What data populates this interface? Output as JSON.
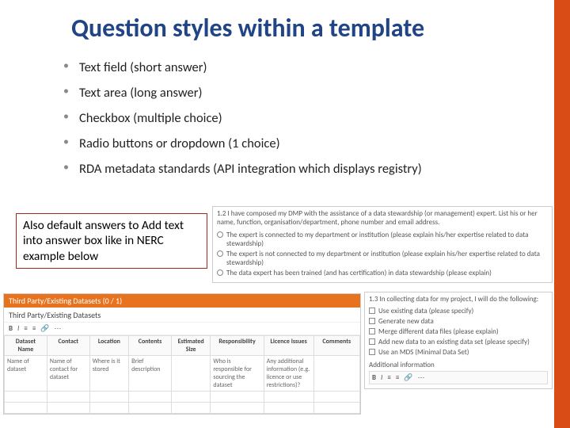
{
  "title": "Question styles within a template",
  "bullets": [
    "Text field (short answer)",
    "Text area (long answer)",
    "Checkbox (multiple choice)",
    "Radio buttons or dropdown (1 choice)",
    "RDA metadata standards (API integration which displays registry)"
  ],
  "callout": "Also default answers to Add text into answer box like in NERC example below",
  "panel12": {
    "question": "1.2 I have composed my DMP with the assistance of a data stewardship (or management) expert. List his or her name, function, organisation/department, phone number and email address.",
    "options": [
      "The expert is connected to my department or institution (please explain his/her expertise related to data stewardship)",
      "The expert is not connected to my department or institution (please explain his/her expertise related to data stewardship)",
      "The data expert has been trained (and has certification) in data stewardship (please explain)"
    ]
  },
  "panel13": {
    "question": "1.3 In collecting data for my project, I will do the following:",
    "options": [
      "Use existing data (please specify)",
      "Generate new data",
      "Merge different data files (please explain)",
      "Add new data to an existing data set (please specify)",
      "Use an MDS (Minimal Data Set)"
    ],
    "additional_label": "Additional information",
    "toolbar": {
      "b": "B",
      "i": "I",
      "list1": "≡",
      "list2": "≡",
      "link": "🔗",
      "more": "⋯"
    }
  },
  "nerc": {
    "header": "Third Party/Existing Datasets (0 / 1)",
    "subheader": "Third Party/Existing Datasets",
    "toolbar": {
      "b": "B",
      "i": "I",
      "list1": "≡",
      "list2": "≡",
      "link": "🔗",
      "more": "⋯"
    },
    "columns": [
      "Dataset Name",
      "Contact",
      "Location",
      "Contents",
      "Estimated Size",
      "Responsibility",
      "Licence Issues",
      "Comments"
    ],
    "hints": [
      "Name of dataset",
      "Name of contact for dataset",
      "Where is it stored",
      "Brief description",
      "",
      "Who is responsible for sourcing the dataset",
      "Any additional information (e.g. licence or use restrictions)?",
      ""
    ]
  }
}
